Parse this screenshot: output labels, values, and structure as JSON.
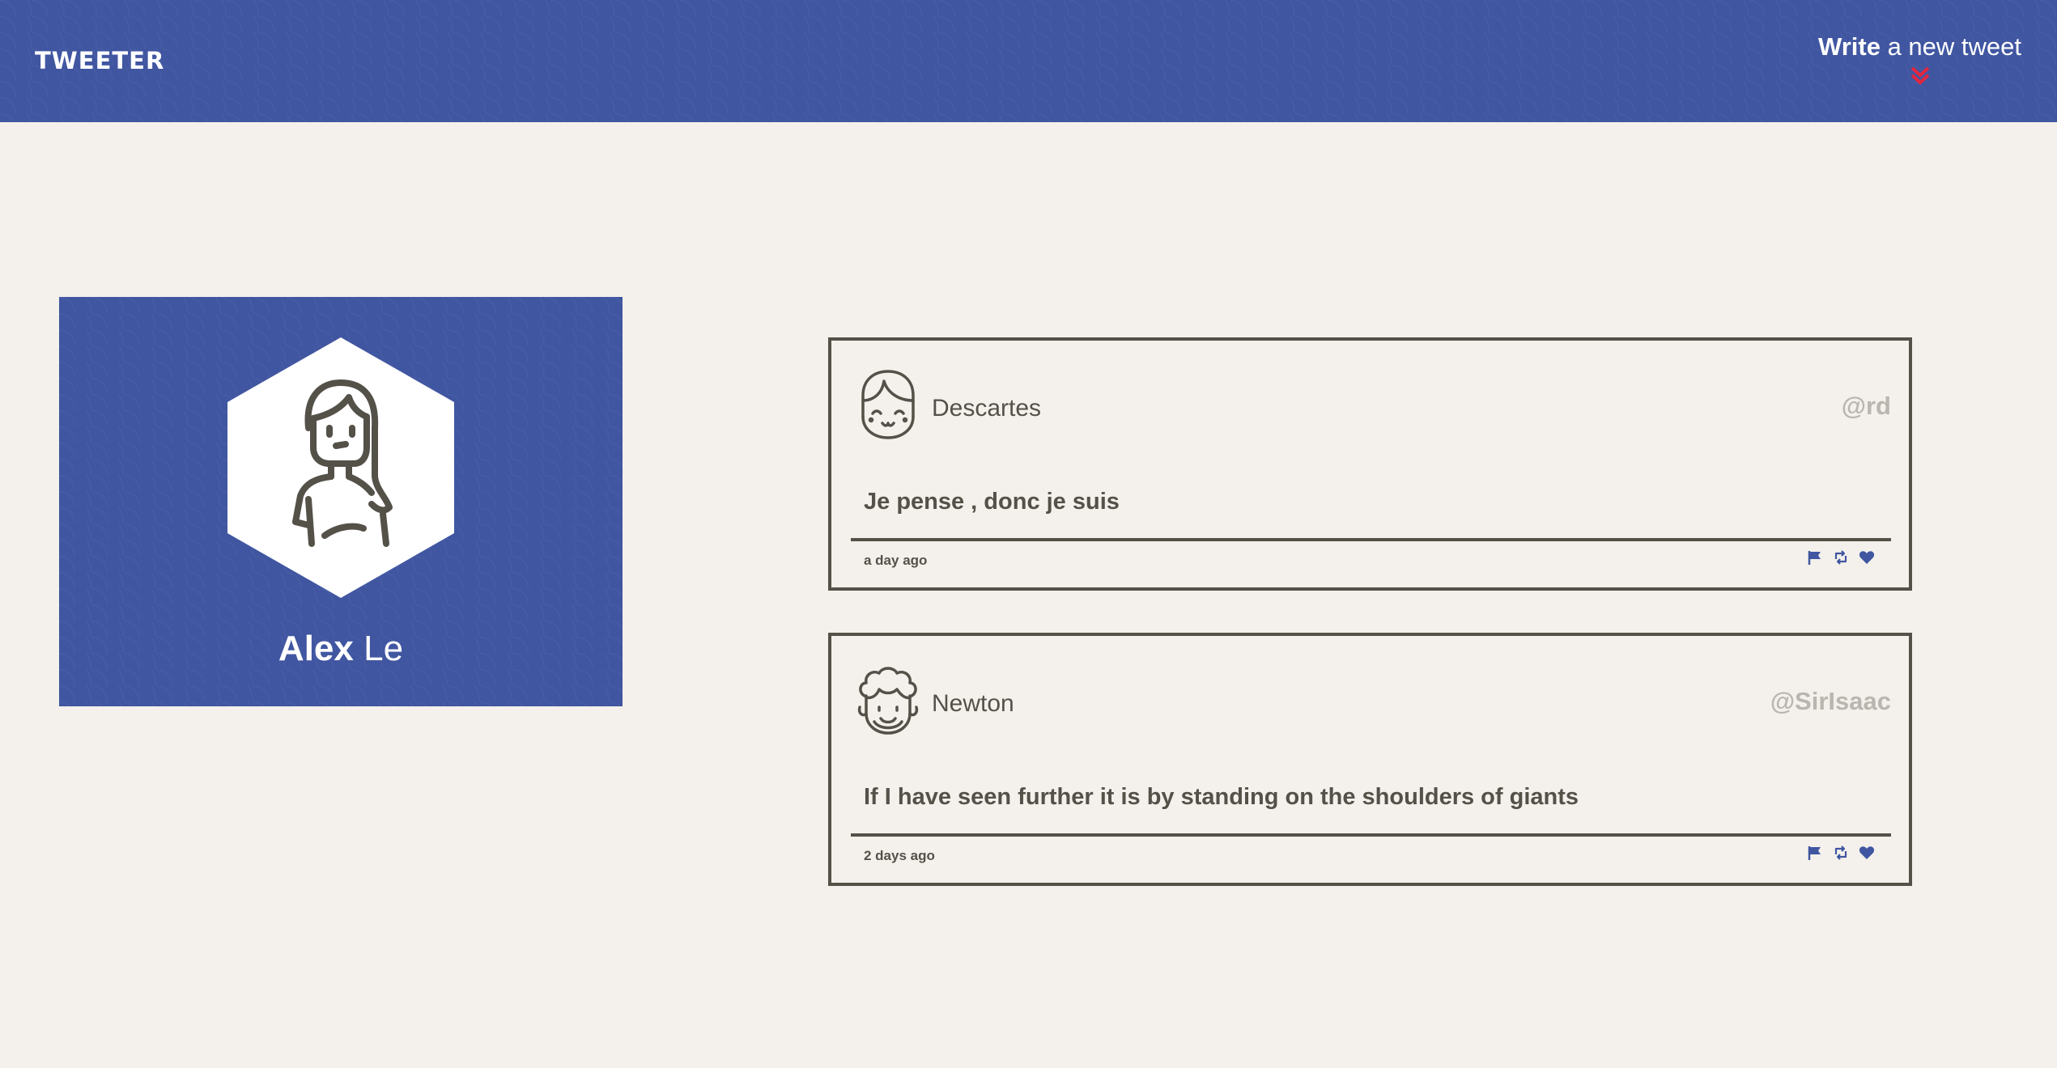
{
  "nav": {
    "brand": "TWEETER",
    "compose_strong": "Write",
    "compose_rest": " a new tweet",
    "accent_color": "#e2263f",
    "bg_color": "#4056a1"
  },
  "profile": {
    "first_name": "Alex",
    "last_name": "Le"
  },
  "tweets": [
    {
      "author": "Descartes",
      "handle": "@rd",
      "content": "Je pense , donc je suis",
      "time": "a day ago",
      "avatar_icon": "girl-avatar-icon"
    },
    {
      "author": "Newton",
      "handle": "@SirIsaac",
      "content": "If I have seen further it is by standing on the shoulders of giants",
      "time": "2 days ago",
      "avatar_icon": "curly-hair-avatar-icon"
    }
  ],
  "icons": {
    "flag": "flag-icon",
    "retweet": "retweet-icon",
    "like": "heart-icon"
  }
}
